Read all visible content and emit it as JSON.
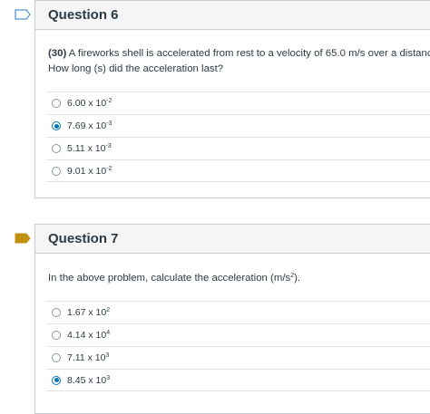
{
  "questions": [
    {
      "title": "Question 6",
      "text_bold": "(30)",
      "text_line1": " A fireworks shell is accelerated from rest to a velocity of 65.0 m/s over a distance of",
      "text_line2": "How long (s) did the acceleration last?",
      "flag_state": "unflagged",
      "answers": [
        {
          "mantissa": "6.00 x 10",
          "exp": "-2",
          "selected": false
        },
        {
          "mantissa": "7.69 x 10",
          "exp": "-3",
          "selected": true
        },
        {
          "mantissa": "5.11 x 10",
          "exp": "-3",
          "selected": false
        },
        {
          "mantissa": "9.01 x 10",
          "exp": "-2",
          "selected": false
        }
      ]
    },
    {
      "title": "Question 7",
      "text_before": "In the above problem, calculate the acceleration (m/s",
      "text_sup": "2",
      "text_after": ").",
      "flag_state": "flagged",
      "answers": [
        {
          "mantissa": "1.67 x 10",
          "exp": "2",
          "selected": false
        },
        {
          "mantissa": "4.14 x 10",
          "exp": "4",
          "selected": false
        },
        {
          "mantissa": "7.11 x 10",
          "exp": "3",
          "selected": false
        },
        {
          "mantissa": "8.45 x 10",
          "exp": "3",
          "selected": true
        }
      ]
    }
  ],
  "colors": {
    "flag_active": "#c2900f",
    "flag_inactive": "#2b7abc",
    "radio_selected": "#0374b5"
  }
}
